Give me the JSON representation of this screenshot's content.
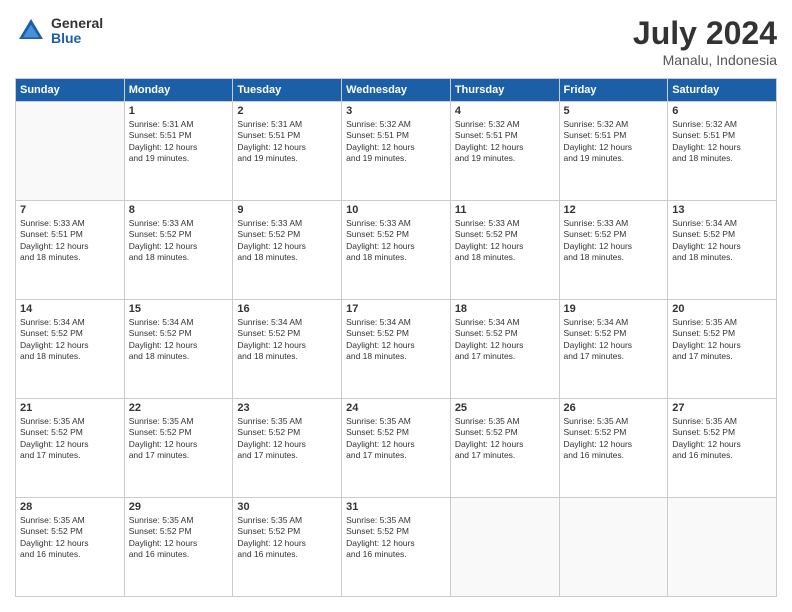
{
  "logo": {
    "general": "General",
    "blue": "Blue"
  },
  "header": {
    "month_year": "July 2024",
    "location": "Manalu, Indonesia"
  },
  "days_of_week": [
    "Sunday",
    "Monday",
    "Tuesday",
    "Wednesday",
    "Thursday",
    "Friday",
    "Saturday"
  ],
  "weeks": [
    [
      {
        "day": "",
        "info": ""
      },
      {
        "day": "1",
        "info": "Sunrise: 5:31 AM\nSunset: 5:51 PM\nDaylight: 12 hours\nand 19 minutes."
      },
      {
        "day": "2",
        "info": "Sunrise: 5:31 AM\nSunset: 5:51 PM\nDaylight: 12 hours\nand 19 minutes."
      },
      {
        "day": "3",
        "info": "Sunrise: 5:32 AM\nSunset: 5:51 PM\nDaylight: 12 hours\nand 19 minutes."
      },
      {
        "day": "4",
        "info": "Sunrise: 5:32 AM\nSunset: 5:51 PM\nDaylight: 12 hours\nand 19 minutes."
      },
      {
        "day": "5",
        "info": "Sunrise: 5:32 AM\nSunset: 5:51 PM\nDaylight: 12 hours\nand 19 minutes."
      },
      {
        "day": "6",
        "info": "Sunrise: 5:32 AM\nSunset: 5:51 PM\nDaylight: 12 hours\nand 18 minutes."
      }
    ],
    [
      {
        "day": "7",
        "info": "Sunrise: 5:33 AM\nSunset: 5:51 PM\nDaylight: 12 hours\nand 18 minutes."
      },
      {
        "day": "8",
        "info": "Sunrise: 5:33 AM\nSunset: 5:52 PM\nDaylight: 12 hours\nand 18 minutes."
      },
      {
        "day": "9",
        "info": "Sunrise: 5:33 AM\nSunset: 5:52 PM\nDaylight: 12 hours\nand 18 minutes."
      },
      {
        "day": "10",
        "info": "Sunrise: 5:33 AM\nSunset: 5:52 PM\nDaylight: 12 hours\nand 18 minutes."
      },
      {
        "day": "11",
        "info": "Sunrise: 5:33 AM\nSunset: 5:52 PM\nDaylight: 12 hours\nand 18 minutes."
      },
      {
        "day": "12",
        "info": "Sunrise: 5:33 AM\nSunset: 5:52 PM\nDaylight: 12 hours\nand 18 minutes."
      },
      {
        "day": "13",
        "info": "Sunrise: 5:34 AM\nSunset: 5:52 PM\nDaylight: 12 hours\nand 18 minutes."
      }
    ],
    [
      {
        "day": "14",
        "info": "Sunrise: 5:34 AM\nSunset: 5:52 PM\nDaylight: 12 hours\nand 18 minutes."
      },
      {
        "day": "15",
        "info": "Sunrise: 5:34 AM\nSunset: 5:52 PM\nDaylight: 12 hours\nand 18 minutes."
      },
      {
        "day": "16",
        "info": "Sunrise: 5:34 AM\nSunset: 5:52 PM\nDaylight: 12 hours\nand 18 minutes."
      },
      {
        "day": "17",
        "info": "Sunrise: 5:34 AM\nSunset: 5:52 PM\nDaylight: 12 hours\nand 18 minutes."
      },
      {
        "day": "18",
        "info": "Sunrise: 5:34 AM\nSunset: 5:52 PM\nDaylight: 12 hours\nand 17 minutes."
      },
      {
        "day": "19",
        "info": "Sunrise: 5:34 AM\nSunset: 5:52 PM\nDaylight: 12 hours\nand 17 minutes."
      },
      {
        "day": "20",
        "info": "Sunrise: 5:35 AM\nSunset: 5:52 PM\nDaylight: 12 hours\nand 17 minutes."
      }
    ],
    [
      {
        "day": "21",
        "info": "Sunrise: 5:35 AM\nSunset: 5:52 PM\nDaylight: 12 hours\nand 17 minutes."
      },
      {
        "day": "22",
        "info": "Sunrise: 5:35 AM\nSunset: 5:52 PM\nDaylight: 12 hours\nand 17 minutes."
      },
      {
        "day": "23",
        "info": "Sunrise: 5:35 AM\nSunset: 5:52 PM\nDaylight: 12 hours\nand 17 minutes."
      },
      {
        "day": "24",
        "info": "Sunrise: 5:35 AM\nSunset: 5:52 PM\nDaylight: 12 hours\nand 17 minutes."
      },
      {
        "day": "25",
        "info": "Sunrise: 5:35 AM\nSunset: 5:52 PM\nDaylight: 12 hours\nand 17 minutes."
      },
      {
        "day": "26",
        "info": "Sunrise: 5:35 AM\nSunset: 5:52 PM\nDaylight: 12 hours\nand 16 minutes."
      },
      {
        "day": "27",
        "info": "Sunrise: 5:35 AM\nSunset: 5:52 PM\nDaylight: 12 hours\nand 16 minutes."
      }
    ],
    [
      {
        "day": "28",
        "info": "Sunrise: 5:35 AM\nSunset: 5:52 PM\nDaylight: 12 hours\nand 16 minutes."
      },
      {
        "day": "29",
        "info": "Sunrise: 5:35 AM\nSunset: 5:52 PM\nDaylight: 12 hours\nand 16 minutes."
      },
      {
        "day": "30",
        "info": "Sunrise: 5:35 AM\nSunset: 5:52 PM\nDaylight: 12 hours\nand 16 minutes."
      },
      {
        "day": "31",
        "info": "Sunrise: 5:35 AM\nSunset: 5:52 PM\nDaylight: 12 hours\nand 16 minutes."
      },
      {
        "day": "",
        "info": ""
      },
      {
        "day": "",
        "info": ""
      },
      {
        "day": "",
        "info": ""
      }
    ]
  ]
}
